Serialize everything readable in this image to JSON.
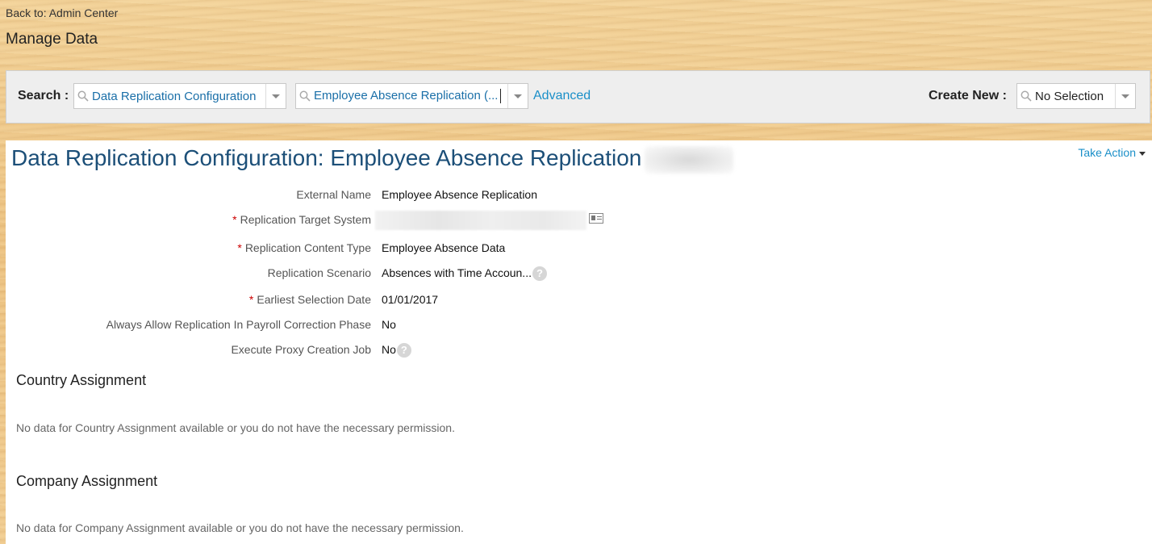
{
  "nav": {
    "back_link": "Back to: Admin Center",
    "page_title": "Manage Data"
  },
  "search": {
    "label": "Search :",
    "object_type": "Data Replication Configuration",
    "object_instance": "Employee Absence Replication (...",
    "advanced_link": "Advanced",
    "create_new_label": "Create New :",
    "create_new_value": "No Selection"
  },
  "record": {
    "title": "Data Replication Configuration: Employee Absence Replication",
    "take_action": "Take Action",
    "fields": [
      {
        "label": "External Name",
        "required": false,
        "value": "Employee Absence Replication"
      },
      {
        "label": "Replication Target System",
        "required": true,
        "value": ""
      },
      {
        "label": "Replication Content Type",
        "required": true,
        "value": "Employee Absence Data"
      },
      {
        "label": "Replication Scenario",
        "required": false,
        "value": "Absences with Time Accoun..."
      },
      {
        "label": "Earliest Selection Date",
        "required": true,
        "value": "01/01/2017"
      },
      {
        "label": "Always Allow Replication In Payroll Correction Phase",
        "required": false,
        "value": "No"
      },
      {
        "label": "Execute Proxy Creation Job",
        "required": false,
        "value": "No"
      }
    ],
    "required_marker": "*",
    "help_glyph": "?"
  },
  "sections": [
    {
      "title": "Country Assignment",
      "message": "No data for Country Assignment available or you do not have the necessary permission."
    },
    {
      "title": "Company Assignment",
      "message": "No data for Company Assignment available or you do not have the necessary permission."
    }
  ]
}
